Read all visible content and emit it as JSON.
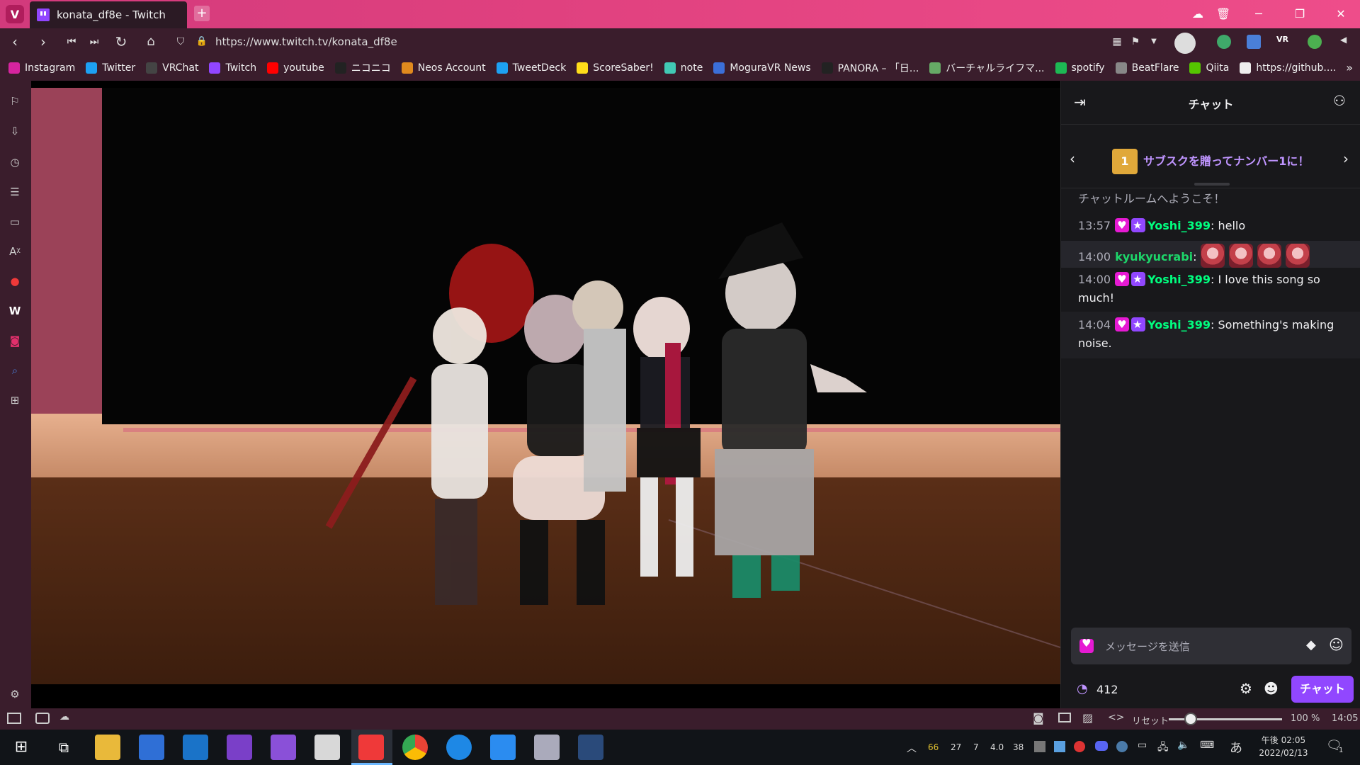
{
  "window": {
    "tab_title": "konata_df8e - Twitch",
    "new_tab": "+",
    "controls": [
      "☁",
      "🗑",
      "─",
      "❐",
      "✕"
    ]
  },
  "address": {
    "url": "https://www.twitch.tv/konata_df8e"
  },
  "bookmarks": [
    {
      "label": "Instagram",
      "color": "#d6249f"
    },
    {
      "label": "Twitter",
      "color": "#1da1f2"
    },
    {
      "label": "VRChat",
      "color": "#444"
    },
    {
      "label": "Twitch",
      "color": "#9146ff"
    },
    {
      "label": "youtube",
      "color": "#ff0000"
    },
    {
      "label": "ニコニコ",
      "color": "#222"
    },
    {
      "label": "Neos Account",
      "color": "#e08a1e"
    },
    {
      "label": "TweetDeck",
      "color": "#1da1f2"
    },
    {
      "label": "ScoreSaber!",
      "color": "#ffde1a"
    },
    {
      "label": "note",
      "color": "#41c9b4"
    },
    {
      "label": "MoguraVR News",
      "color": "#3b6fd8"
    },
    {
      "label": "PANORA – 「日...",
      "color": "#222"
    },
    {
      "label": "バーチャルライフマ...",
      "color": "#6a6"
    },
    {
      "label": "spotify",
      "color": "#1db954"
    },
    {
      "label": "BeatFlare",
      "color": "#888"
    },
    {
      "label": "Qiita",
      "color": "#55c500"
    },
    {
      "label": "https://github....",
      "color": "#eee"
    }
  ],
  "chat": {
    "title": "チャット",
    "gift_banner": "サブスクを贈ってナンバー1に！",
    "welcome": "チャットルームへようこそ！",
    "messages": [
      {
        "time": "13:57",
        "user": "Yoshi_399",
        "text": ": hello"
      },
      {
        "time": "14:00",
        "user": "kyukyucrabi",
        "text": ":"
      },
      {
        "time": "14:00",
        "user": "Yoshi_399",
        "text": ": I love this song so much!"
      },
      {
        "time": "14:04",
        "user": "Yoshi_399",
        "text": ": Something's making noise."
      }
    ],
    "input_placeholder": "メッセージを送信",
    "points": "412",
    "send_button": "チャット"
  },
  "statusbar": {
    "reset": "リセット",
    "zoom": "100 %",
    "time": "14:05"
  },
  "taskbar": {
    "tray_numbers": [
      "66",
      "27",
      "7",
      "4.0",
      "38"
    ],
    "ime": "あ",
    "clock_time": "午後 02:05",
    "clock_date": "2022/02/13",
    "notifications": "1"
  }
}
